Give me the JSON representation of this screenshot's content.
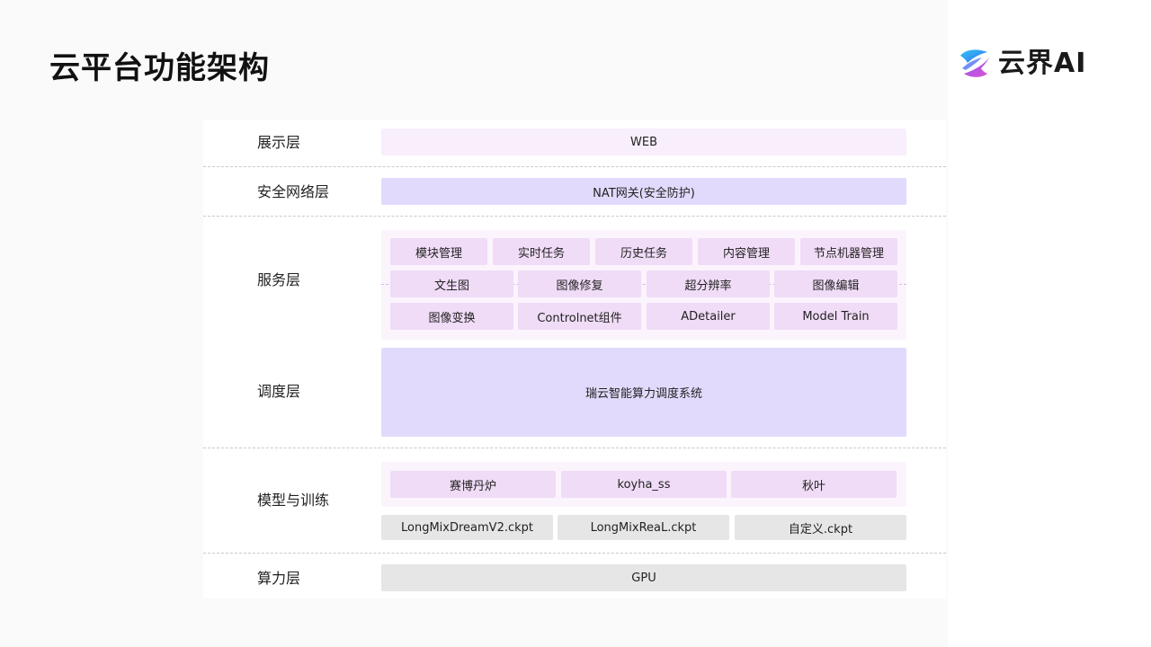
{
  "title": "云平台功能架构",
  "logo": {
    "text": "云界AI",
    "icon": "yunjie-logo-icon"
  },
  "layers": {
    "display": {
      "label": "展示层",
      "box": "WEB"
    },
    "security": {
      "label": "安全网络层",
      "box": "NAT网关(安全防护)"
    },
    "service": {
      "label": "服务层",
      "row1": [
        "模块管理",
        "实时任务",
        "历史任务",
        "内容管理",
        "节点机器管理"
      ],
      "row2": [
        "文生图",
        "图像修复",
        "超分辨率",
        "图像编辑"
      ],
      "row3": [
        "图像变换",
        "Controlnet组件",
        "ADetailer",
        "Model Train"
      ]
    },
    "schedule": {
      "label": "调度层",
      "box": "瑞云智能算力调度系统"
    },
    "model": {
      "label": "模型与训练",
      "tools": [
        "赛博丹炉",
        "koyha_ss",
        "秋叶"
      ],
      "checkpoints": [
        "LongMixDreamV2.ckpt",
        "LongMixReaL.ckpt",
        "自定义.ckpt"
      ]
    },
    "compute": {
      "label": "算力层",
      "box": "GPU"
    }
  },
  "colors": {
    "web_bg": "#f8eefc",
    "purple_bg": "#e2dafc",
    "service_item_bg": "#f0dcf7",
    "gray_bg": "#e6e6e6"
  }
}
